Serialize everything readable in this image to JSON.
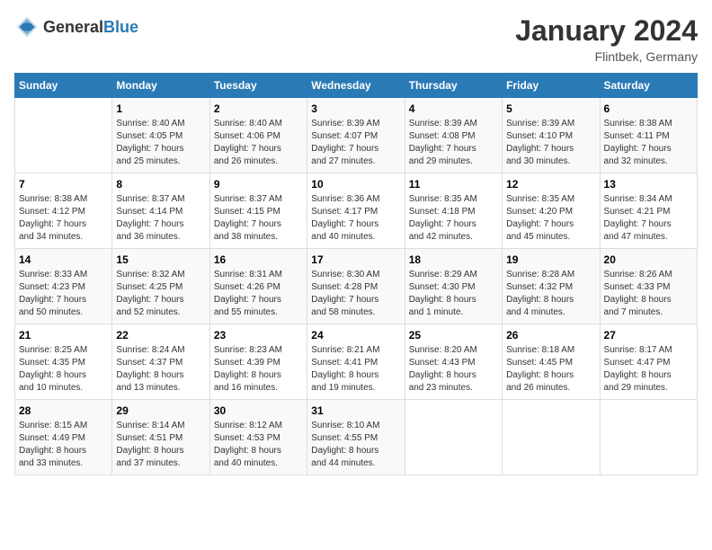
{
  "header": {
    "logo_general": "General",
    "logo_blue": "Blue",
    "month_year": "January 2024",
    "location": "Flintbek, Germany"
  },
  "days_of_week": [
    "Sunday",
    "Monday",
    "Tuesday",
    "Wednesday",
    "Thursday",
    "Friday",
    "Saturday"
  ],
  "weeks": [
    [
      {
        "day": "",
        "info": ""
      },
      {
        "day": "1",
        "info": "Sunrise: 8:40 AM\nSunset: 4:05 PM\nDaylight: 7 hours\nand 25 minutes."
      },
      {
        "day": "2",
        "info": "Sunrise: 8:40 AM\nSunset: 4:06 PM\nDaylight: 7 hours\nand 26 minutes."
      },
      {
        "day": "3",
        "info": "Sunrise: 8:39 AM\nSunset: 4:07 PM\nDaylight: 7 hours\nand 27 minutes."
      },
      {
        "day": "4",
        "info": "Sunrise: 8:39 AM\nSunset: 4:08 PM\nDaylight: 7 hours\nand 29 minutes."
      },
      {
        "day": "5",
        "info": "Sunrise: 8:39 AM\nSunset: 4:10 PM\nDaylight: 7 hours\nand 30 minutes."
      },
      {
        "day": "6",
        "info": "Sunrise: 8:38 AM\nSunset: 4:11 PM\nDaylight: 7 hours\nand 32 minutes."
      }
    ],
    [
      {
        "day": "7",
        "info": "Sunrise: 8:38 AM\nSunset: 4:12 PM\nDaylight: 7 hours\nand 34 minutes."
      },
      {
        "day": "8",
        "info": "Sunrise: 8:37 AM\nSunset: 4:14 PM\nDaylight: 7 hours\nand 36 minutes."
      },
      {
        "day": "9",
        "info": "Sunrise: 8:37 AM\nSunset: 4:15 PM\nDaylight: 7 hours\nand 38 minutes."
      },
      {
        "day": "10",
        "info": "Sunrise: 8:36 AM\nSunset: 4:17 PM\nDaylight: 7 hours\nand 40 minutes."
      },
      {
        "day": "11",
        "info": "Sunrise: 8:35 AM\nSunset: 4:18 PM\nDaylight: 7 hours\nand 42 minutes."
      },
      {
        "day": "12",
        "info": "Sunrise: 8:35 AM\nSunset: 4:20 PM\nDaylight: 7 hours\nand 45 minutes."
      },
      {
        "day": "13",
        "info": "Sunrise: 8:34 AM\nSunset: 4:21 PM\nDaylight: 7 hours\nand 47 minutes."
      }
    ],
    [
      {
        "day": "14",
        "info": "Sunrise: 8:33 AM\nSunset: 4:23 PM\nDaylight: 7 hours\nand 50 minutes."
      },
      {
        "day": "15",
        "info": "Sunrise: 8:32 AM\nSunset: 4:25 PM\nDaylight: 7 hours\nand 52 minutes."
      },
      {
        "day": "16",
        "info": "Sunrise: 8:31 AM\nSunset: 4:26 PM\nDaylight: 7 hours\nand 55 minutes."
      },
      {
        "day": "17",
        "info": "Sunrise: 8:30 AM\nSunset: 4:28 PM\nDaylight: 7 hours\nand 58 minutes."
      },
      {
        "day": "18",
        "info": "Sunrise: 8:29 AM\nSunset: 4:30 PM\nDaylight: 8 hours\nand 1 minute."
      },
      {
        "day": "19",
        "info": "Sunrise: 8:28 AM\nSunset: 4:32 PM\nDaylight: 8 hours\nand 4 minutes."
      },
      {
        "day": "20",
        "info": "Sunrise: 8:26 AM\nSunset: 4:33 PM\nDaylight: 8 hours\nand 7 minutes."
      }
    ],
    [
      {
        "day": "21",
        "info": "Sunrise: 8:25 AM\nSunset: 4:35 PM\nDaylight: 8 hours\nand 10 minutes."
      },
      {
        "day": "22",
        "info": "Sunrise: 8:24 AM\nSunset: 4:37 PM\nDaylight: 8 hours\nand 13 minutes."
      },
      {
        "day": "23",
        "info": "Sunrise: 8:23 AM\nSunset: 4:39 PM\nDaylight: 8 hours\nand 16 minutes."
      },
      {
        "day": "24",
        "info": "Sunrise: 8:21 AM\nSunset: 4:41 PM\nDaylight: 8 hours\nand 19 minutes."
      },
      {
        "day": "25",
        "info": "Sunrise: 8:20 AM\nSunset: 4:43 PM\nDaylight: 8 hours\nand 23 minutes."
      },
      {
        "day": "26",
        "info": "Sunrise: 8:18 AM\nSunset: 4:45 PM\nDaylight: 8 hours\nand 26 minutes."
      },
      {
        "day": "27",
        "info": "Sunrise: 8:17 AM\nSunset: 4:47 PM\nDaylight: 8 hours\nand 29 minutes."
      }
    ],
    [
      {
        "day": "28",
        "info": "Sunrise: 8:15 AM\nSunset: 4:49 PM\nDaylight: 8 hours\nand 33 minutes."
      },
      {
        "day": "29",
        "info": "Sunrise: 8:14 AM\nSunset: 4:51 PM\nDaylight: 8 hours\nand 37 minutes."
      },
      {
        "day": "30",
        "info": "Sunrise: 8:12 AM\nSunset: 4:53 PM\nDaylight: 8 hours\nand 40 minutes."
      },
      {
        "day": "31",
        "info": "Sunrise: 8:10 AM\nSunset: 4:55 PM\nDaylight: 8 hours\nand 44 minutes."
      },
      {
        "day": "",
        "info": ""
      },
      {
        "day": "",
        "info": ""
      },
      {
        "day": "",
        "info": ""
      }
    ]
  ]
}
